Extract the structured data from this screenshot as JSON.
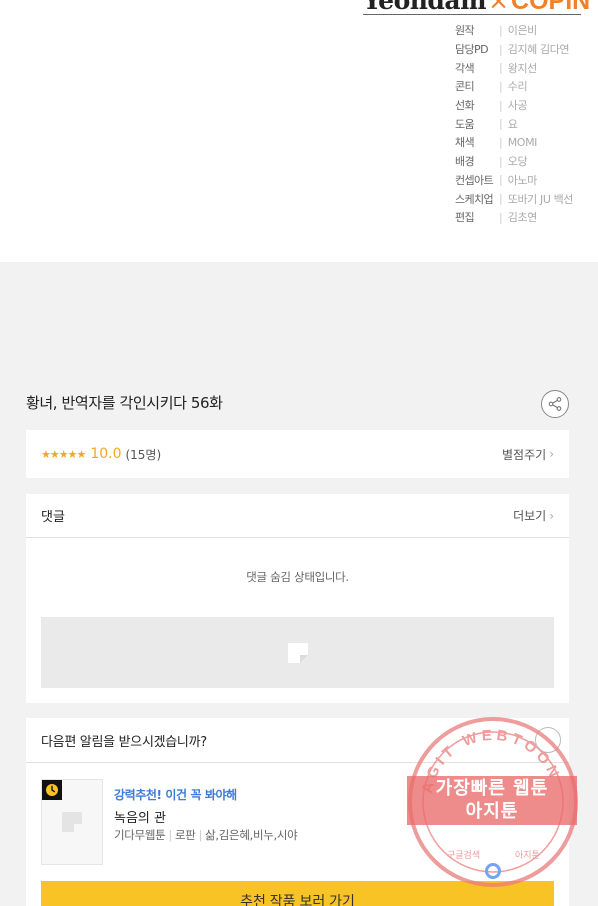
{
  "brand": {
    "left": "Yeondam",
    "separator": "×",
    "right": "COPIN"
  },
  "credits": [
    {
      "role": "원작",
      "name": "이은비"
    },
    {
      "role": "담당PD",
      "name": "김지혜  김다연"
    },
    {
      "role": "각색",
      "name": "왕지선"
    },
    {
      "role": "콘티",
      "name": "수리"
    },
    {
      "role": "선화",
      "name": "사공"
    },
    {
      "role": "도움",
      "name": "요"
    },
    {
      "role": "채색",
      "name": "MOMI"
    },
    {
      "role": "배경",
      "name": "오당"
    },
    {
      "role": "컨셉아트",
      "name": "아노마"
    },
    {
      "role": "스케치업",
      "name": "또바기  JU  백선"
    },
    {
      "role": "편집",
      "name": "김초연"
    }
  ],
  "episode": {
    "title": "황녀, 반역자를 각인시키다 56화"
  },
  "rating": {
    "stars": "★★★★★",
    "score": "10.0",
    "count": "(15명)",
    "rate_label": "별점주기",
    "chevron": "›"
  },
  "comments": {
    "title": "댓글",
    "more_label": "더보기",
    "chevron": "›",
    "hidden_message": "댓글 숨김 상태입니다."
  },
  "next_notice": {
    "question": "다음편 알림을 받으시겠습니까?",
    "recommend": {
      "tag": "강력추천! 이건 꼭 봐야해",
      "name": "녹음의 관",
      "meta": [
        "기다무웹툰",
        "로판",
        "삶,김은혜,비누,시야"
      ]
    },
    "cta_label": "추천 작품 보러 가기"
  },
  "watermark": {
    "ring_text": "AGIT WEBTOON",
    "band_line1": "가장빠른 웹툰",
    "band_line2": "아지툰",
    "bottom_left": "구글검색",
    "bottom_right": "아지툰"
  },
  "colors": {
    "accent_orange": "#f0812a",
    "star": "#f5a623",
    "link_blue": "#3b7bd9",
    "cta_yellow": "#f7c325",
    "stamp_red": "#e96b6b"
  }
}
